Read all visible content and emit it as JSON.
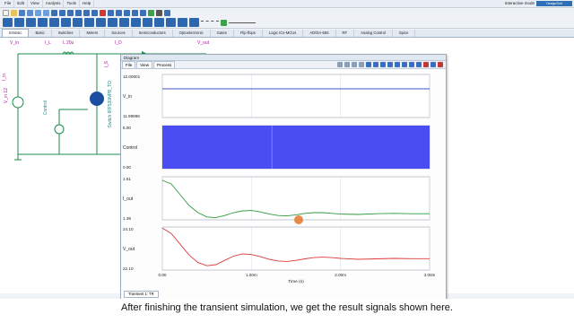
{
  "menubar": {
    "items": [
      "File",
      "Edit",
      "View",
      "Analysis",
      "Tools",
      "Help"
    ],
    "mode": "Interactive mode",
    "logo": "DesignSoft"
  },
  "component_tabs": [
    "Intrinsic",
    "Basic",
    "Switches",
    "Meters",
    "Sources",
    "Semiconductors",
    "Optoelectronic",
    "Gates",
    "Flip-flops",
    "Logic ICs-MCUs",
    "AD/DA-555",
    "RF",
    "Analog Control",
    "Spice"
  ],
  "schematic": {
    "labels": {
      "vin": "V_in",
      "il": "I_L",
      "l": "L 20u",
      "is": "I_S",
      "id": "I_D",
      "vout": "V_out",
      "iin": "I_in",
      "vin12": "V_in 12",
      "control": "Control",
      "switch": "Switch IRF530NPB_TO"
    }
  },
  "diagram": {
    "title": "Diagram",
    "menu": [
      "File",
      "View",
      "Process"
    ],
    "status_tab": "Transient 1: TR"
  },
  "chart_data": [
    {
      "type": "line",
      "ylabel": "V_in",
      "ylim": [
        11.99998,
        12.00001
      ],
      "tick_labels": [
        "12.00001",
        "11.99998"
      ],
      "color": "#4455cc",
      "series": [
        {
          "x": [
            0,
            0.003
          ],
          "values": [
            12.0,
            12.0
          ]
        }
      ]
    },
    {
      "type": "area",
      "ylabel": "Control",
      "ylim": [
        0,
        5
      ],
      "tick_labels": [
        "5.00",
        "0.00"
      ],
      "color": "#4a4ef2",
      "series": [
        {
          "x": [
            0,
            0.003
          ],
          "values": [
            5,
            5
          ]
        }
      ]
    },
    {
      "type": "line",
      "ylabel": "I_out",
      "ylim": [
        1.39,
        1.51
      ],
      "tick_labels": [
        "1.51",
        "1.39"
      ],
      "color": "#2e9b3a",
      "series": [
        {
          "x": [
            0,
            0.0001,
            0.0002,
            0.0003,
            0.0004,
            0.0005,
            0.0006,
            0.0007,
            0.0008,
            0.0009,
            0.001,
            0.0011,
            0.0012,
            0.0013,
            0.0014,
            0.0015,
            0.0016,
            0.0017,
            0.0018,
            0.0019,
            0.002,
            0.0022,
            0.0024,
            0.0026,
            0.0028,
            0.003
          ],
          "values": [
            1.5,
            1.49,
            1.46,
            1.43,
            1.41,
            1.398,
            1.396,
            1.402,
            1.41,
            1.415,
            1.416,
            1.412,
            1.406,
            1.402,
            1.401,
            1.404,
            1.408,
            1.41,
            1.41,
            1.408,
            1.406,
            1.405,
            1.407,
            1.408,
            1.407,
            1.407
          ]
        }
      ]
    },
    {
      "type": "line",
      "ylabel": "V_out",
      "ylim": [
        22.1,
        24.1
      ],
      "tick_labels": [
        "24.10",
        "22.10"
      ],
      "color": "#e03a3a",
      "series": [
        {
          "x": [
            0,
            0.0001,
            0.0002,
            0.0003,
            0.0004,
            0.0005,
            0.0006,
            0.0007,
            0.0008,
            0.0009,
            0.001,
            0.0011,
            0.0012,
            0.0013,
            0.0014,
            0.0015,
            0.0016,
            0.0017,
            0.0018,
            0.0019,
            0.002,
            0.0022,
            0.0024,
            0.0026,
            0.0028,
            0.003
          ],
          "values": [
            24.05,
            23.8,
            23.3,
            22.8,
            22.45,
            22.3,
            22.35,
            22.55,
            22.75,
            22.85,
            22.82,
            22.72,
            22.6,
            22.52,
            22.5,
            22.55,
            22.62,
            22.68,
            22.7,
            22.68,
            22.64,
            22.6,
            22.62,
            22.64,
            22.63,
            22.63
          ]
        }
      ]
    }
  ],
  "x_axis": {
    "label": "Time (s)",
    "ticks": [
      0,
      0.001,
      0.002,
      0.003
    ],
    "tick_labels": [
      "0.00",
      "1.00m",
      "2.00m",
      "3.00m"
    ]
  },
  "caption": "After finishing the transient simulation, we get the result signals shown here."
}
